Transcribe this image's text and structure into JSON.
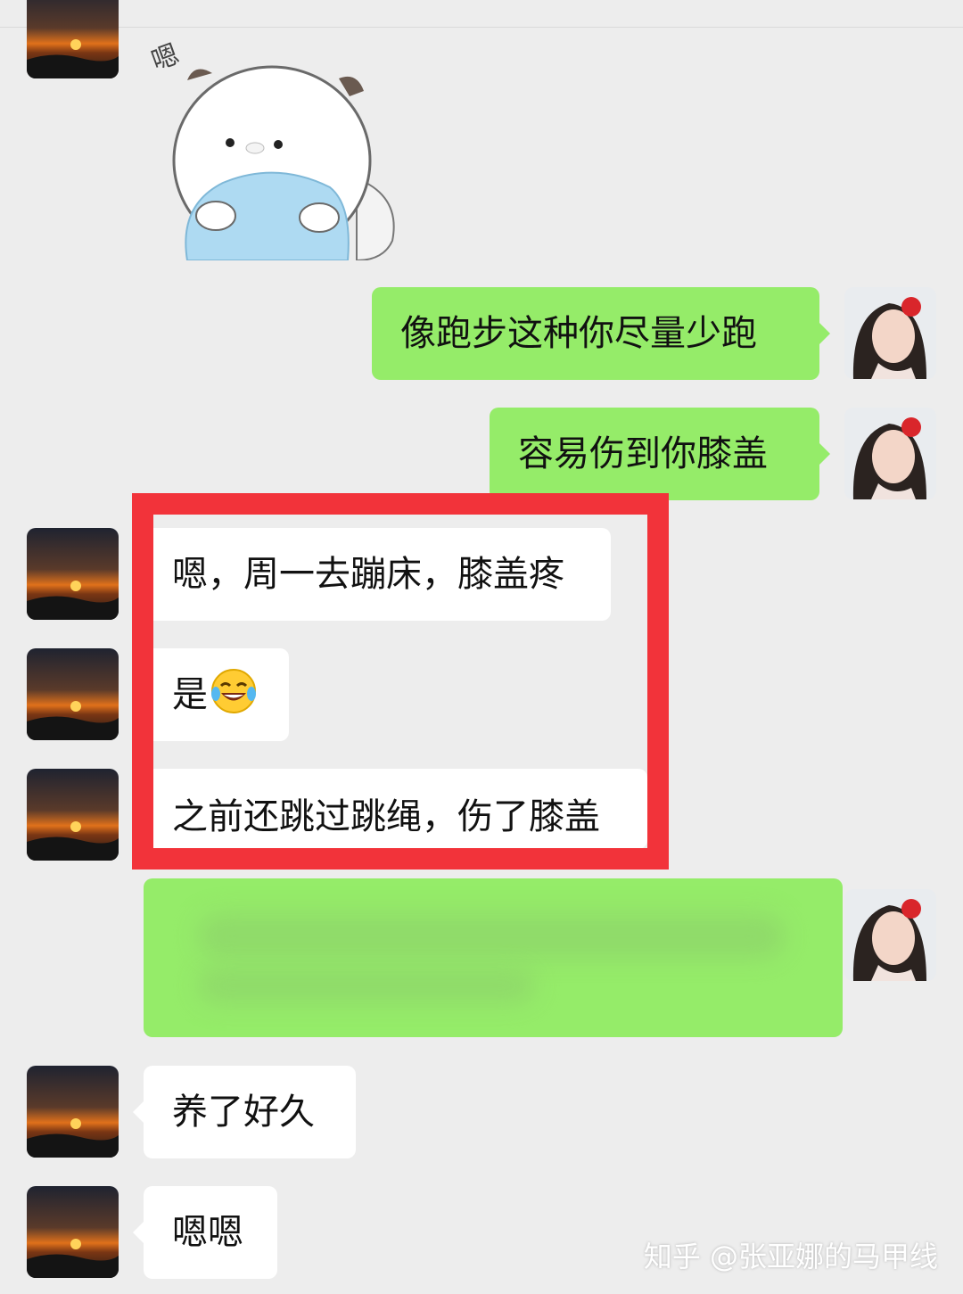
{
  "messages": [
    {
      "side": "right",
      "text": "像跑步这种你尽量少跑"
    },
    {
      "side": "right",
      "text": "容易伤到你膝盖"
    },
    {
      "side": "left",
      "text": "嗯，周一去蹦床，膝盖疼"
    },
    {
      "side": "left",
      "text": "是"
    },
    {
      "side": "left",
      "text": "之前还跳过跳绳，伤了膝盖"
    },
    {
      "side": "left",
      "text": "养了好久"
    },
    {
      "side": "left",
      "text": "嗯嗯"
    }
  ],
  "sticker": {
    "caption": "嗯"
  },
  "emoji": {
    "name": "laugh-cry-icon"
  },
  "watermark": "知乎 @张亚娜的马甲线",
  "colors": {
    "self_bubble": "#95ec69",
    "other_bubble": "#ffffff",
    "highlight": "#f2333a",
    "background": "#ededed"
  }
}
